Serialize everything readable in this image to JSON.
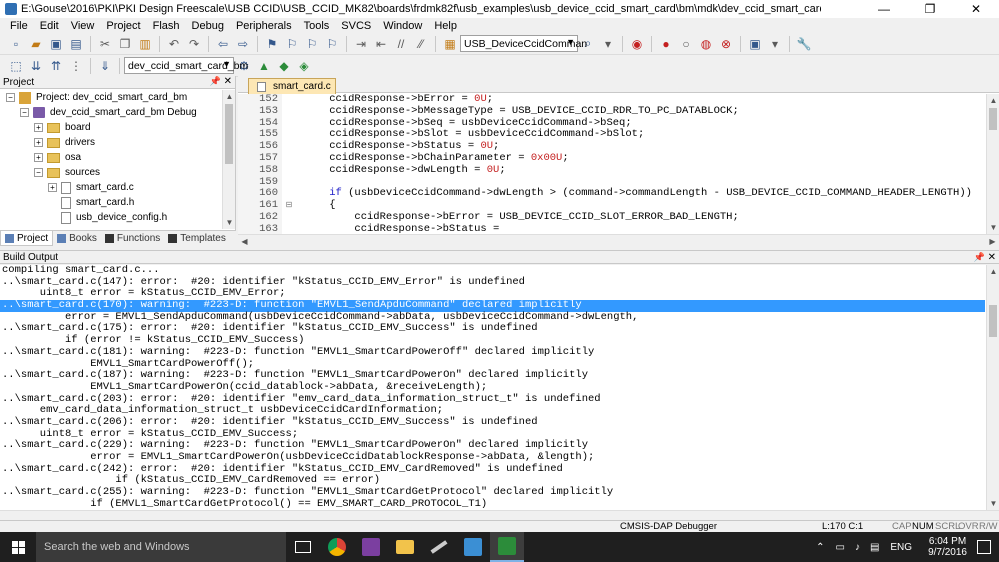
{
  "window": {
    "title": "E:\\Gouse\\2016\\PKI\\PKI Design Freescale\\USB CCID\\USB_CCID_MK82\\boards\\frdmk82f\\usb_examples\\usb_device_ccid_smart_card\\bm\\mdk\\dev_ccid_smart_card_bm.uvprojx - µ",
    "min": "—",
    "restore": "❐",
    "close": "✕"
  },
  "menu": [
    "File",
    "Edit",
    "View",
    "Project",
    "Flash",
    "Debug",
    "Peripherals",
    "Tools",
    "SVCS",
    "Window",
    "Help"
  ],
  "toolbar": {
    "function_combo": "USB_DeviceCcidComman",
    "target_combo": "dev_ccid_smart_card_bm"
  },
  "project_pane": {
    "header": "Project",
    "tree": [
      {
        "label": "Project: dev_ccid_smart_card_bm",
        "level": 0,
        "expander": "−",
        "icon": "project"
      },
      {
        "label": "dev_ccid_smart_card_bm Debug",
        "level": 1,
        "expander": "−",
        "icon": "target"
      },
      {
        "label": "board",
        "level": 2,
        "expander": "+",
        "icon": "folder"
      },
      {
        "label": "drivers",
        "level": 2,
        "expander": "+",
        "icon": "folder"
      },
      {
        "label": "osa",
        "level": 2,
        "expander": "+",
        "icon": "folder"
      },
      {
        "label": "sources",
        "level": 2,
        "expander": "−",
        "icon": "folder"
      },
      {
        "label": "smart_card.c",
        "level": 3,
        "expander": "+",
        "icon": "file"
      },
      {
        "label": "smart_card.h",
        "level": 3,
        "expander": "",
        "icon": "file"
      },
      {
        "label": "usb_device_config.h",
        "level": 3,
        "expander": "",
        "icon": "file"
      }
    ],
    "tabs": [
      "Project",
      "Books",
      "Functions",
      "Templates"
    ]
  },
  "editor": {
    "tab": "smart_card.c",
    "lines": [
      {
        "n": "152",
        "fold": "",
        "code": "    ccidResponse->bError = ",
        "num": "0U",
        "tail": ";"
      },
      {
        "n": "153",
        "fold": "",
        "code": "    ccidResponse->bMessageType = USB_DEVICE_CCID_RDR_TO_PC_DATABLOCK;",
        "num": "",
        "tail": ""
      },
      {
        "n": "154",
        "fold": "",
        "code": "    ccidResponse->bSeq = usbDeviceCcidCommand->bSeq;",
        "num": "",
        "tail": ""
      },
      {
        "n": "155",
        "fold": "",
        "code": "    ccidResponse->bSlot = usbDeviceCcidCommand->bSlot;",
        "num": "",
        "tail": ""
      },
      {
        "n": "156",
        "fold": "",
        "code": "    ccidResponse->bStatus = ",
        "num": "0U",
        "tail": ";"
      },
      {
        "n": "157",
        "fold": "",
        "code": "    ccidResponse->bChainParameter = ",
        "num": "0x00U",
        "tail": ";"
      },
      {
        "n": "158",
        "fold": "",
        "code": "    ccidResponse->dwLength = ",
        "num": "0U",
        "tail": ";"
      },
      {
        "n": "159",
        "fold": "",
        "code": "",
        "num": "",
        "tail": ""
      },
      {
        "n": "160",
        "fold": "",
        "code": "    if (usbDeviceCcidCommand->dwLength > (command->commandLength - USB_DEVICE_CCID_COMMAND_HEADER_LENGTH))",
        "num": "",
        "tail": ""
      },
      {
        "n": "161",
        "fold": "⊟",
        "code": "    {",
        "num": "",
        "tail": ""
      },
      {
        "n": "162",
        "fold": "",
        "code": "        ccidResponse->bError = USB_DEVICE_CCID_SLOT_ERROR_BAD_LENGTH;",
        "num": "",
        "tail": ""
      },
      {
        "n": "163",
        "fold": "",
        "code": "        ccidResponse->bStatus = ",
        "num": "",
        "tail": ""
      }
    ]
  },
  "build": {
    "header": "Build Output",
    "lines": [
      "compiling smart_card.c...",
      "..\\smart_card.c(147): error:  #20: identifier \"kStatus_CCID_EMV_Error\" is undefined",
      "      uint8_t error = kStatus_CCID_EMV_Error;",
      "..\\smart_card.c(170): warning:  #223-D: function \"EMVL1_SendApduCommand\" declared implicitly",
      "          error = EMVL1_SendApduCommand(usbDeviceCcidCommand->abData, usbDeviceCcidCommand->dwLength,",
      "..\\smart_card.c(175): error:  #20: identifier \"kStatus_CCID_EMV_Success\" is undefined",
      "          if (error != kStatus_CCID_EMV_Success)",
      "..\\smart_card.c(181): warning:  #223-D: function \"EMVL1_SmartCardPowerOff\" declared implicitly",
      "              EMVL1_SmartCardPowerOff();",
      "..\\smart_card.c(187): warning:  #223-D: function \"EMVL1_SmartCardPowerOn\" declared implicitly",
      "              EMVL1_SmartCardPowerOn(ccid_datablock->abData, &receiveLength);",
      "..\\smart_card.c(203): error:  #20: identifier \"emv_card_data_information_struct_t\" is undefined",
      "      emv_card_data_information_struct_t usbDeviceCcidCardInformation;",
      "..\\smart_card.c(206): error:  #20: identifier \"kStatus_CCID_EMV_Success\" is undefined",
      "      uint8_t error = kStatus_CCID_EMV_Success;",
      "..\\smart_card.c(229): warning:  #223-D: function \"EMVL1_SmartCardPowerOn\" declared implicitly",
      "              error = EMVL1_SmartCardPowerOn(usbDeviceCcidDatablockResponse->abData, &length);",
      "..\\smart_card.c(242): error:  #20: identifier \"kStatus_CCID_EMV_CardRemoved\" is undefined",
      "                  if (kStatus_CCID_EMV_CardRemoved == error)",
      "..\\smart_card.c(255): warning:  #223-D: function \"EMVL1_SmartCardGetProtocol\" declared implicitly",
      "              if (EMVL1_SmartCardGetProtocol() == EMV_SMART_CARD_PROTOCOL_T1)"
    ],
    "selected_index": 3
  },
  "status": {
    "debugger": "CMSIS-DAP Debugger",
    "position": "L:170 C:1",
    "cap": "CAP",
    "num": "NUM",
    "scrl": "SCRL",
    "ovr": "OVR",
    "rw": "R/W"
  },
  "taskbar": {
    "search_placeholder": "Search the web and Windows",
    "lang": "ENG",
    "time": "6:04 PM",
    "date": "9/7/2016"
  },
  "colors": {
    "selection": "#3399ff",
    "numeric_literal": "#c42020",
    "taskbar": "#1f1f1f"
  }
}
